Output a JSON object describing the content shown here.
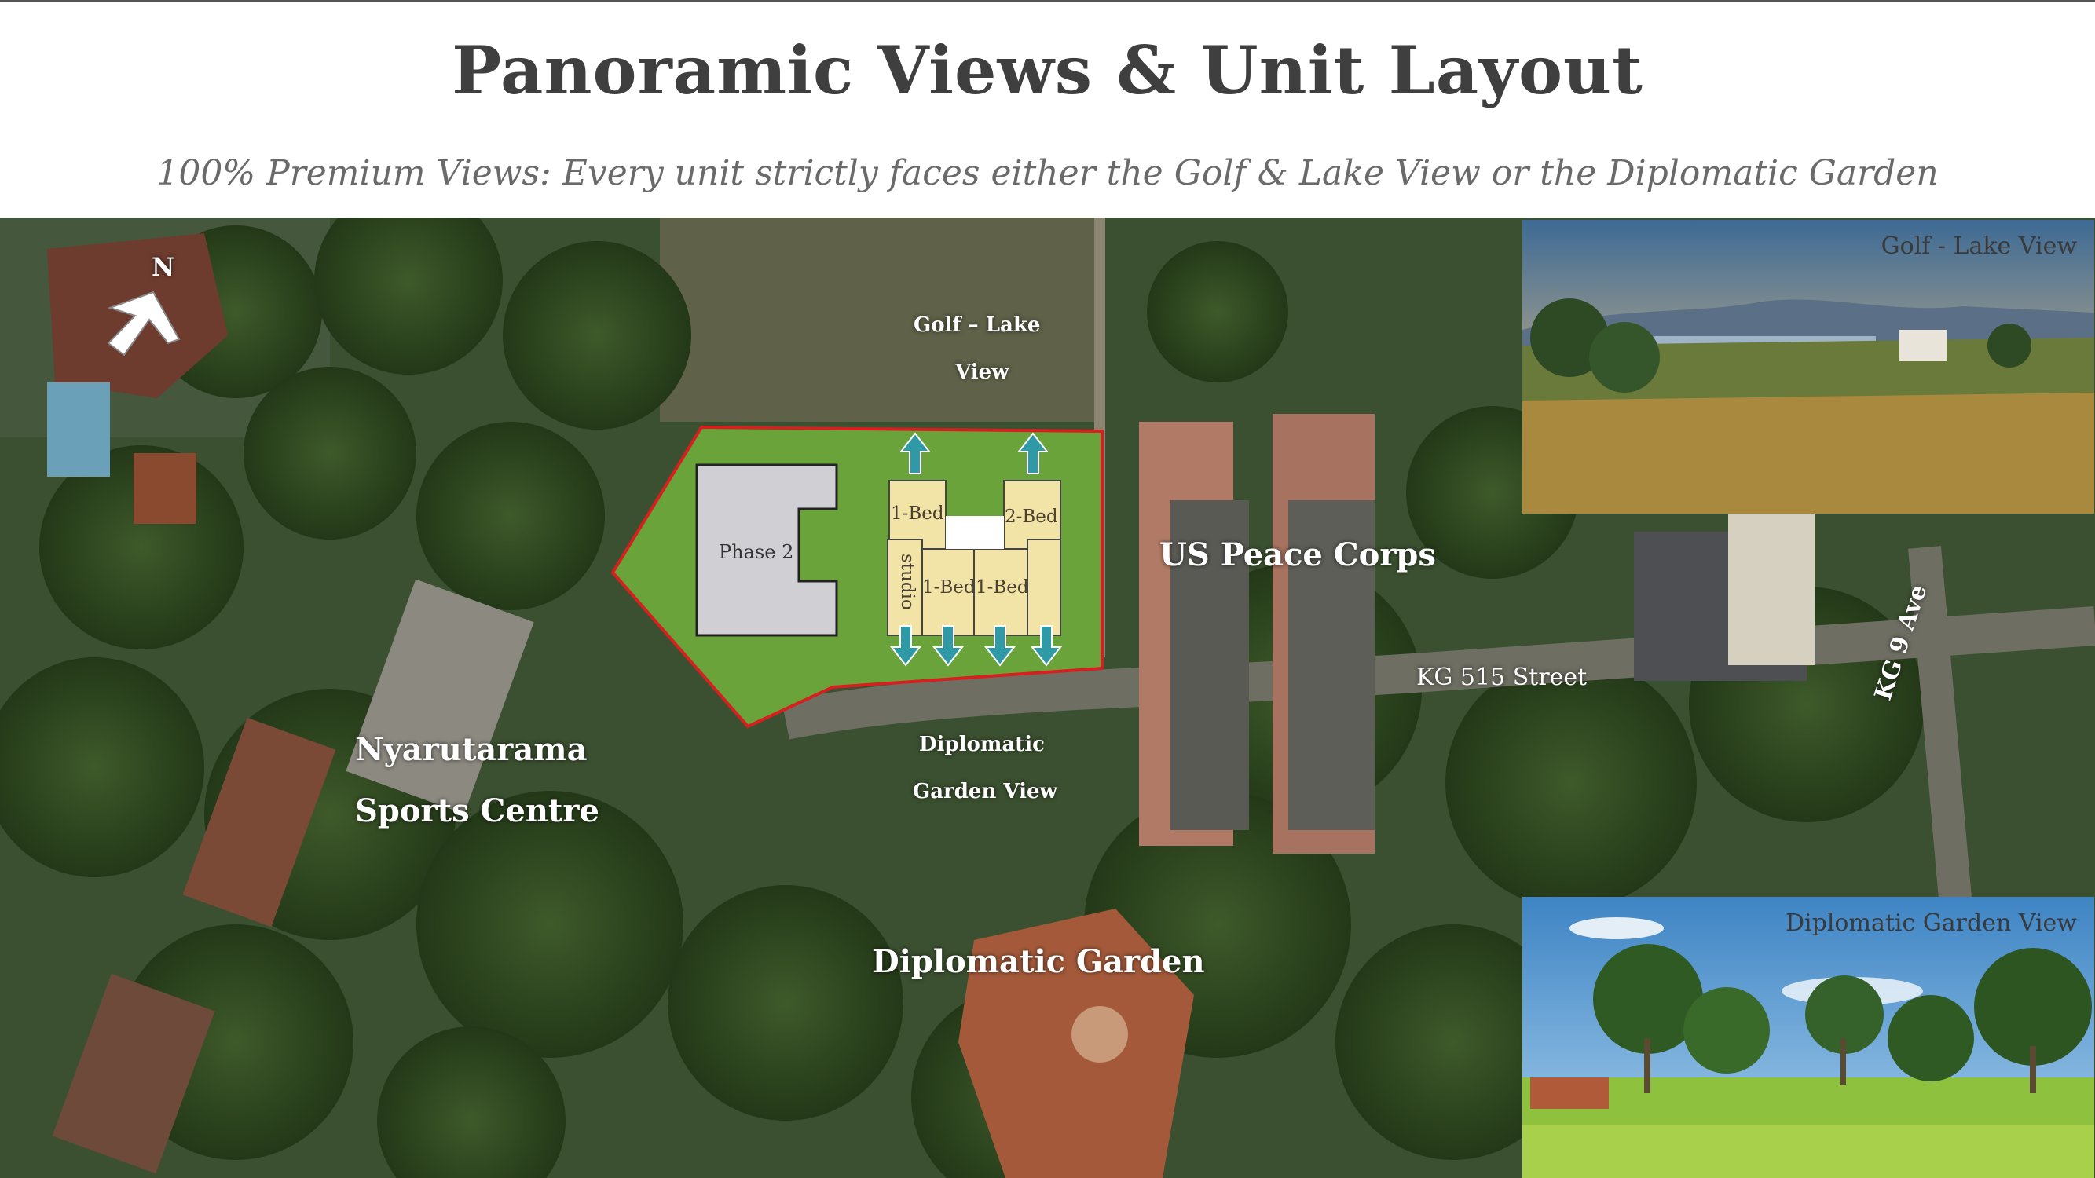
{
  "header": {
    "title": "Panoramic Views & Unit Layout",
    "subtitle": "100% Premium Views: Every unit strictly faces either the Golf & Lake View or the Diplomatic Garden"
  },
  "map": {
    "compass": "N",
    "labels": {
      "golf_view_line1": "Golf – Lake",
      "golf_view_line2": "View",
      "diplomatic_view_line1": "Diplomatic",
      "diplomatic_view_line2": "Garden View",
      "us_peace_corps": "US Peace Corps",
      "sports_centre_line1": "Nyarutarama",
      "sports_centre_line2": "Sports Centre",
      "diplomatic_garden": "Diplomatic Garden",
      "street_kg515": "KG 515 Street",
      "street_kg9": "KG 9 Ave"
    },
    "site_plan": {
      "phase2": "Phase 2",
      "units": [
        "1-Bed",
        "2-Bed",
        "studio",
        "1-Bed",
        "1-Bed"
      ]
    }
  },
  "photos": {
    "golf_caption": "Golf - Lake View",
    "garden_caption": "Diplomatic Garden View"
  },
  "colors": {
    "site_green": "#6aa33a",
    "site_border": "#d62020",
    "arrow_teal": "#2f9aa6",
    "unit_fill": "#f2e3a6"
  }
}
